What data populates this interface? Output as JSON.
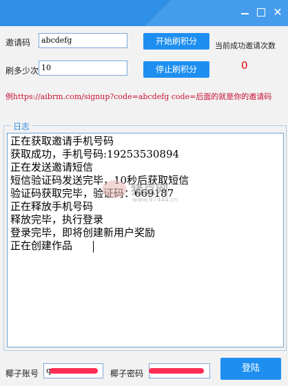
{
  "form": {
    "invite_label": "邀请码",
    "invite_value": "abcdefg",
    "count_label": "刷多少次",
    "count_value": "10",
    "start_button": "开始刷积分",
    "stop_button": "停止刷积分",
    "success_label": "当前成功邀请次数",
    "success_count": "0",
    "example_text": "例https://aibrm.com/signup?code=abcdefg  code=后面的就是你的邀请码"
  },
  "log": {
    "title": "日志",
    "lines": [
      "正在获取邀请手机号码",
      "获取成功，手机号码:19253530894",
      "正在发送邀请短信",
      "短信验证码发送完毕，10秒后获取短信",
      "验证码获取完毕，验证码：669187",
      "正在释放手机号码",
      "释放完毕，执行登录",
      "登录完毕，即将创建新用户奖励",
      "正在创建作品"
    ]
  },
  "watermark": {
    "text": "猪豆网",
    "url": "www.97444.cn"
  },
  "footer": {
    "account_label": "椰子账号",
    "account_value": "q",
    "password_label": "椰子密码",
    "login_button": "登陆"
  },
  "colors": {
    "accent": "#1e8ff0",
    "error": "#e60012",
    "redaction": "#ff2d55"
  }
}
